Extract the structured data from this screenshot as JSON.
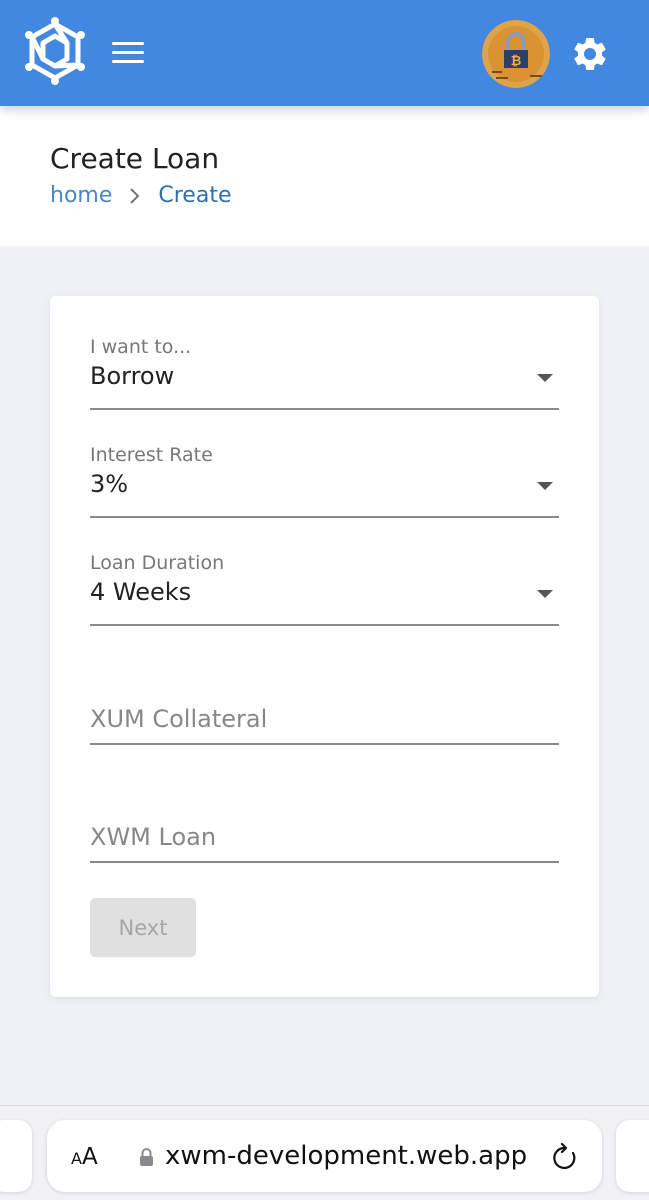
{
  "header": {
    "logo_icon": "xwm-logo-icon",
    "menu_icon": "hamburger-menu-icon",
    "avatar_icon": "bitcoin-lock-avatar",
    "settings_icon": "gear-icon",
    "bg_color": "#4287e0"
  },
  "page": {
    "title": "Create Loan",
    "breadcrumb": {
      "home": "home",
      "current": "Create"
    }
  },
  "form": {
    "intent": {
      "label": "I want to...",
      "value": "Borrow"
    },
    "interest_rate": {
      "label": "Interest Rate",
      "value": "3%"
    },
    "loan_duration": {
      "label": "Loan Duration",
      "value": "4 Weeks"
    },
    "collateral": {
      "placeholder": "XUM Collateral",
      "value": ""
    },
    "loan_amount": {
      "placeholder": "XWM Loan",
      "value": ""
    },
    "next_label": "Next"
  },
  "browser": {
    "text_size_small": "A",
    "text_size_big": "A",
    "url": "xwm-development.web.app",
    "lock_icon": "lock-icon",
    "reload_icon": "reload-icon"
  }
}
